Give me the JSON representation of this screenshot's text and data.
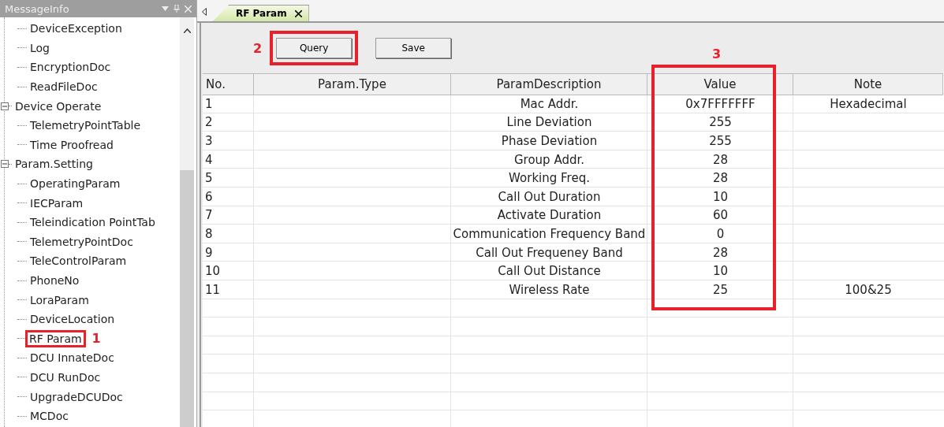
{
  "side_panel": {
    "title": "MessageInfo",
    "tree": {
      "continued_children": [
        {
          "label": "DeviceException",
          "selected": false
        },
        {
          "label": "Log",
          "selected": false
        },
        {
          "label": "EncryptionDoc",
          "selected": false
        },
        {
          "label": "ReadFileDoc",
          "selected": false
        }
      ],
      "nodes": [
        {
          "label": "Device Operate",
          "expanded": true,
          "selected": false,
          "children": [
            {
              "label": "TelemetryPointTable",
              "selected": false
            },
            {
              "label": "Time Proofread",
              "selected": false
            }
          ]
        },
        {
          "label": "Param.Setting",
          "expanded": true,
          "selected": false,
          "children": [
            {
              "label": "OperatingParam",
              "selected": false
            },
            {
              "label": "IECParam",
              "selected": false
            },
            {
              "label": "Teleindication PointTab",
              "selected": false
            },
            {
              "label": "TelemetryPointDoc",
              "selected": false
            },
            {
              "label": "TeleControlParam",
              "selected": false
            },
            {
              "label": "PhoneNo",
              "selected": false
            },
            {
              "label": "LoraParam",
              "selected": false
            },
            {
              "label": "DeviceLocation",
              "selected": false
            },
            {
              "label": "RF Param",
              "selected": false,
              "annotation": "1"
            },
            {
              "label": "DCU InnateDoc",
              "selected": false
            },
            {
              "label": "DCU RunDoc",
              "selected": false
            },
            {
              "label": "UpgradeDCUDoc",
              "selected": false
            },
            {
              "label": "MCDoc",
              "selected": false
            }
          ]
        }
      ]
    }
  },
  "tabs": [
    {
      "label": "RF Param",
      "selected": true
    }
  ],
  "toolbar": {
    "buttons": [
      {
        "label": "Query",
        "annotation": "2"
      },
      {
        "label": "Save"
      }
    ]
  },
  "table": {
    "columns": [
      "No.",
      "Param.Type",
      "ParamDescription",
      "Value",
      "Note"
    ],
    "value_annotation": "3",
    "rows": [
      [
        "1",
        "",
        "Mac Addr.",
        "0x7FFFFFFF",
        "Hexadecimal"
      ],
      [
        "2",
        "",
        "Line Deviation",
        "255",
        ""
      ],
      [
        "3",
        "",
        "Phase Deviation",
        "255",
        ""
      ],
      [
        "4",
        "",
        "Group Addr.",
        "28",
        ""
      ],
      [
        "5",
        "",
        "Working Freq.",
        "28",
        ""
      ],
      [
        "6",
        "",
        "Call Out Duration",
        "10",
        ""
      ],
      [
        "7",
        "",
        "Activate Duration",
        "60",
        ""
      ],
      [
        "8",
        "",
        "Communication Frequency Band",
        "0",
        ""
      ],
      [
        "9",
        "",
        "Call Out Frequeney Band",
        "28",
        ""
      ],
      [
        "10",
        "",
        "Call Out Distance",
        "10",
        ""
      ],
      [
        "11",
        "",
        "Wireless Rate",
        "25",
        "100&25"
      ]
    ]
  }
}
